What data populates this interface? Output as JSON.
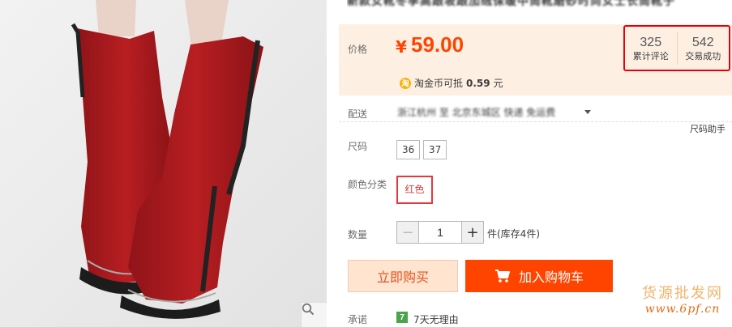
{
  "title": {
    "text": "新款女靴冬季高跟坡跟加绒保暖中筒靴磨砂时尚女士长筒靴子"
  },
  "price": {
    "label": "价格",
    "symbol": "¥",
    "value": "59.00"
  },
  "stats": [
    {
      "num": "325",
      "label": "累计评论"
    },
    {
      "num": "542",
      "label": "交易成功"
    }
  ],
  "coin": {
    "icon": "淘",
    "prefix": "淘金币可抵",
    "amount": "0.59",
    "suffix": "元"
  },
  "shipping": {
    "label": "配送",
    "value": "浙江杭州 至 北京东城区 快递 免运费"
  },
  "size": {
    "label": "尺码",
    "helper": "尺码助手",
    "options": [
      "36",
      "37"
    ]
  },
  "color": {
    "label": "颜色分类",
    "options": [
      "红色"
    ]
  },
  "quantity": {
    "label": "数量",
    "value": "1",
    "minus": "−",
    "plus": "+",
    "stock": "件(库存4件)"
  },
  "actions": {
    "buy_now": "立即购买",
    "add_cart": "加入购物车"
  },
  "promise": {
    "label": "承诺",
    "icon": "7",
    "text": "7天无理由"
  },
  "watermark": {
    "cn": "货源批发网",
    "url": "www.6pf.cn"
  },
  "colors": {
    "accent": "#ff4400",
    "price": "#ff4400",
    "panel": "#fdf0e3",
    "highlight": "#e4000f"
  }
}
